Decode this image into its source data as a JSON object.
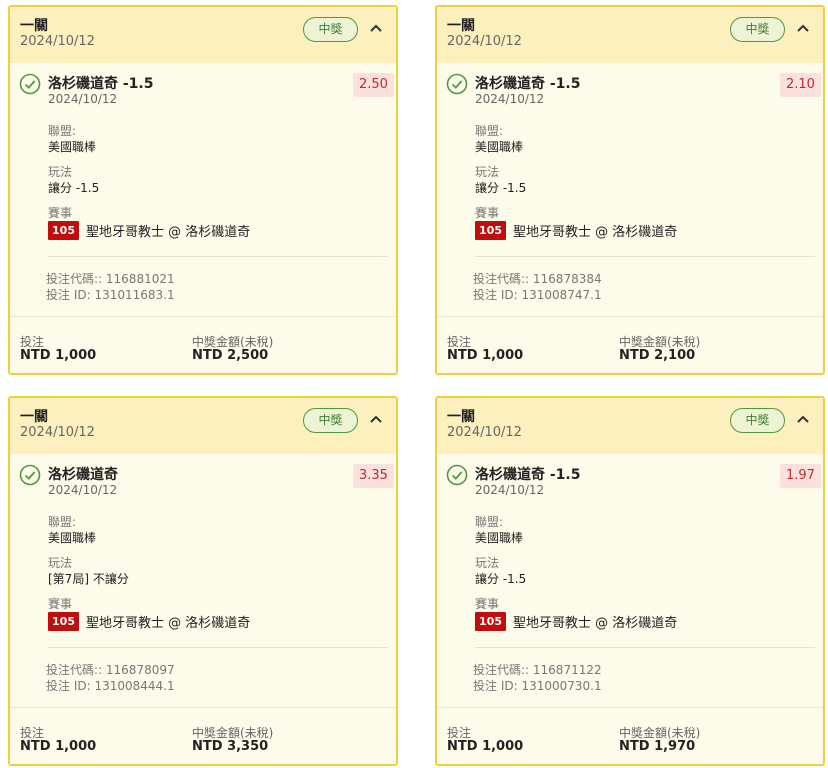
{
  "colors": {
    "border": "#f0cf3e",
    "header_bg": "#fcf0bf",
    "win": "#4f9a3e",
    "odds_bg": "#fbe1de",
    "odds_text": "#c22c2c",
    "event_bg": "#c00d0d"
  },
  "icons": {
    "check": "check-circle-icon",
    "collapse": "chevron-up-icon"
  },
  "labels": {
    "league": "聯盟:",
    "bet_type": "玩法",
    "event": "賽事",
    "stake": "投注",
    "payout": "中獎金額(未稅)"
  },
  "bets": [
    {
      "title": "一關",
      "date": "2024/10/12",
      "status": "中獎",
      "selection": "洛杉磯道奇 -1.5",
      "selection_date": "2024/10/12",
      "odds": "2.50",
      "league": "美國職棒",
      "bet_type": "讓分 -1.5",
      "event_id": "105",
      "event_name": "聖地牙哥教士 @ 洛杉磯道奇",
      "bet_code": "投注代碼:: 116881021",
      "bet_id": "投注 ID: 131011683.1",
      "stake": "NTD 1,000",
      "payout": "NTD 2,500"
    },
    {
      "title": "一關",
      "date": "2024/10/12",
      "status": "中獎",
      "selection": "洛杉磯道奇 -1.5",
      "selection_date": "2024/10/12",
      "odds": "2.10",
      "league": "美國職棒",
      "bet_type": "讓分 -1.5",
      "event_id": "105",
      "event_name": "聖地牙哥教士 @ 洛杉磯道奇",
      "bet_code": "投注代碼:: 116878384",
      "bet_id": "投注 ID: 131008747.1",
      "stake": "NTD 1,000",
      "payout": "NTD 2,100"
    },
    {
      "title": "一關",
      "date": "2024/10/12",
      "status": "中獎",
      "selection": "洛杉磯道奇",
      "selection_date": "2024/10/12",
      "odds": "3.35",
      "league": "美國職棒",
      "bet_type": "[第7局] 不讓分",
      "event_id": "105",
      "event_name": "聖地牙哥教士 @ 洛杉磯道奇",
      "bet_code": "投注代碼:: 116878097",
      "bet_id": "投注 ID: 131008444.1",
      "stake": "NTD 1,000",
      "payout": "NTD 3,350"
    },
    {
      "title": "一關",
      "date": "2024/10/12",
      "status": "中獎",
      "selection": "洛杉磯道奇 -1.5",
      "selection_date": "2024/10/12",
      "odds": "1.97",
      "league": "美國職棒",
      "bet_type": "讓分 -1.5",
      "event_id": "105",
      "event_name": "聖地牙哥教士 @ 洛杉磯道奇",
      "bet_code": "投注代碼:: 116871122",
      "bet_id": "投注 ID: 131000730.1",
      "stake": "NTD 1,000",
      "payout": "NTD 1,970"
    }
  ]
}
